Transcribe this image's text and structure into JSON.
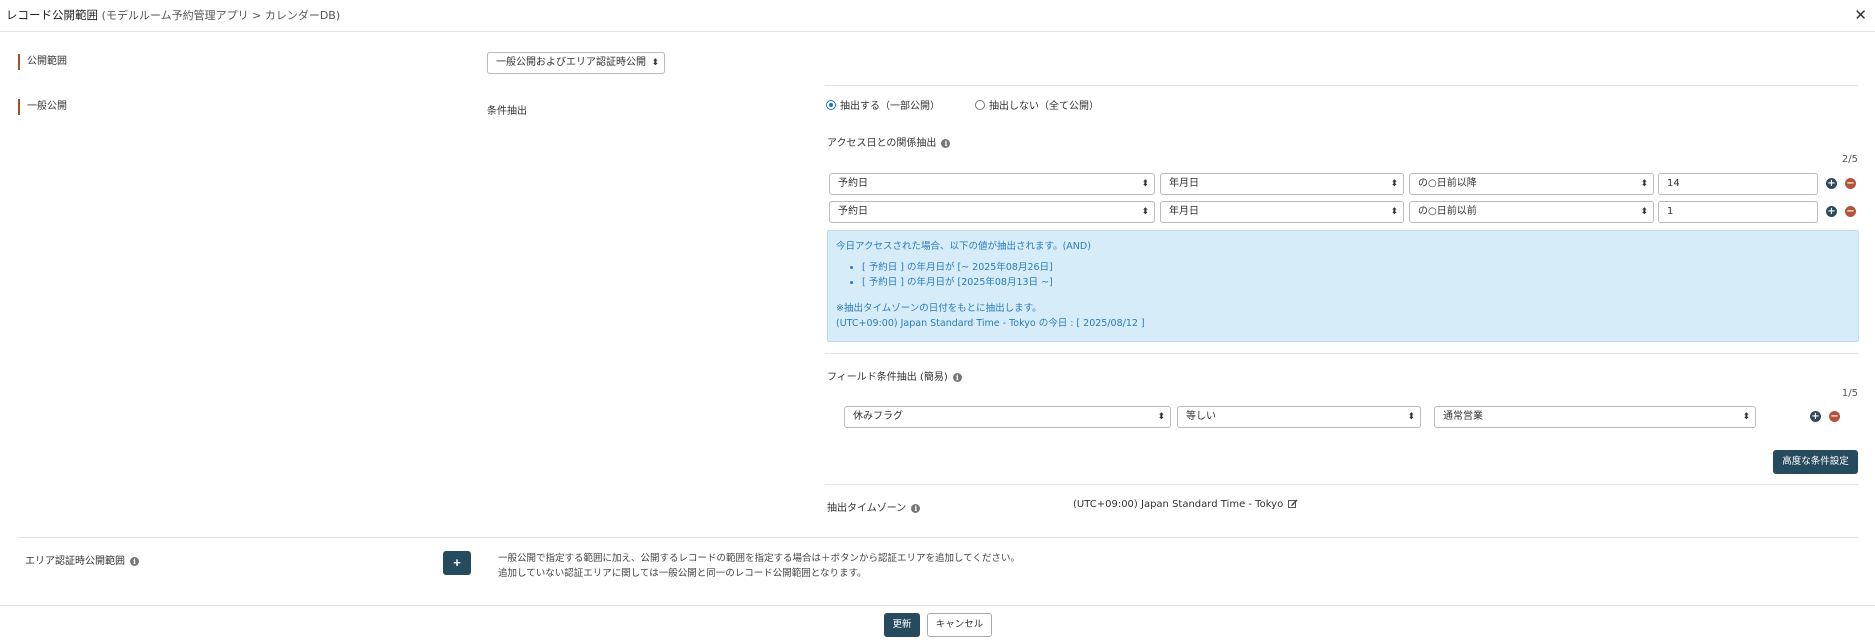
{
  "header": {
    "title": "レコード公開範囲",
    "subtitle": "(モデルルーム予約管理アプリ > カレンダーDB)",
    "close_symbol": "✕"
  },
  "scope": {
    "label": "公開範囲",
    "select_value": "一般公開およびエリア認証時公開"
  },
  "general": {
    "label": "一般公開",
    "condition_label": "条件抽出",
    "radio_extract": "抽出する（一部公開）",
    "radio_no_extract": "抽出しない（全て公開）",
    "radio_selected": "extract"
  },
  "access_date": {
    "heading": "アクセス日との関係抽出",
    "counter": "2/5",
    "rows": [
      {
        "field": "予約日",
        "unit": "年月日",
        "relation": "の○日前以降",
        "value": "14"
      },
      {
        "field": "予約日",
        "unit": "年月日",
        "relation": "の○日前以前",
        "value": "1"
      }
    ],
    "info": {
      "line1": "今日アクセスされた場合、以下の値が抽出されます。(AND)",
      "bullets": [
        "[ 予約日 ] の年月日が [~ 2025年08月26日]",
        "[ 予約日 ] の年月日が [2025年08月13日 ~]"
      ],
      "note1": "※抽出タイムゾーンの日付をもとに抽出します。",
      "note2": "(UTC+09:00) Japan Standard Time - Tokyo の今日 : [ 2025/08/12 ]"
    }
  },
  "field_condition": {
    "heading": "フィールド条件抽出 (簡易)",
    "counter": "1/5",
    "rows": [
      {
        "field": "休みフラグ",
        "operator": "等しい",
        "value": "通常営業"
      }
    ],
    "advanced_button": "高度な条件設定"
  },
  "timezone": {
    "label": "抽出タイムゾーン",
    "value": "(UTC+09:00) Japan Standard Time - Tokyo"
  },
  "area_auth": {
    "label": "エリア認証時公開範囲",
    "add_symbol": "+",
    "desc1": "一般公開で指定する範囲に加え、公開するレコードの範囲を指定する場合は＋ボタンから認証エリアを追加してください。",
    "desc2": "追加していない認証エリアに関しては一般公開と同一のレコード公開範囲となります。"
  },
  "footer": {
    "update_button": "更新",
    "cancel_button": "キャンセル"
  },
  "icons": {
    "select_arrows": "⬍",
    "plus": "+",
    "minus": "−",
    "info": "i"
  }
}
